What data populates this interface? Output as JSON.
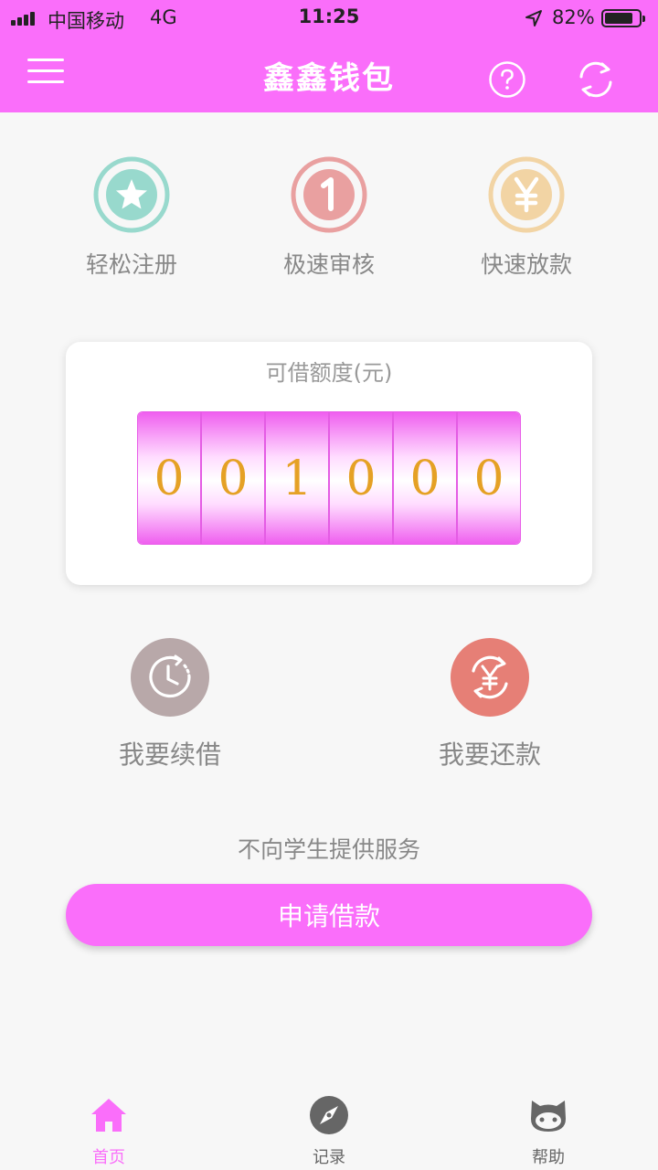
{
  "status_bar": {
    "carrier": "中国移动",
    "network": "4G",
    "time": "11:25",
    "battery": "82%",
    "battery_level": 0.82
  },
  "header": {
    "title": "鑫鑫钱包",
    "menu_icon": "menu-icon",
    "help_icon": "help-icon",
    "refresh_icon": "refresh-icon",
    "background": "#fa6efa"
  },
  "features": [
    {
      "label": "轻松注册",
      "icon": "star-icon",
      "color": "#98d9cd"
    },
    {
      "label": "极速审核",
      "icon": "number-one-icon",
      "color": "#e9a0a0"
    },
    {
      "label": "快速放款",
      "icon": "yen-icon",
      "color": "#f2d4a4"
    }
  ],
  "credit": {
    "title": "可借额度(元)",
    "digits": [
      "0",
      "0",
      "1",
      "0",
      "0",
      "0"
    ]
  },
  "actions": [
    {
      "label": "我要续借",
      "icon": "clock-renew-icon",
      "color": "#b8a8a9"
    },
    {
      "label": "我要还款",
      "icon": "repay-yen-icon",
      "color": "#e67f76"
    }
  ],
  "notice": "不向学生提供服务",
  "apply_button": "申请借款",
  "tabs": [
    {
      "label": "首页",
      "icon": "home-icon",
      "active": true
    },
    {
      "label": "记录",
      "icon": "compass-icon",
      "active": false
    },
    {
      "label": "帮助",
      "icon": "cat-icon",
      "active": false
    }
  ],
  "colors": {
    "accent": "#fa6efa",
    "digit": "#e5a125",
    "text_gray": "#888888"
  }
}
